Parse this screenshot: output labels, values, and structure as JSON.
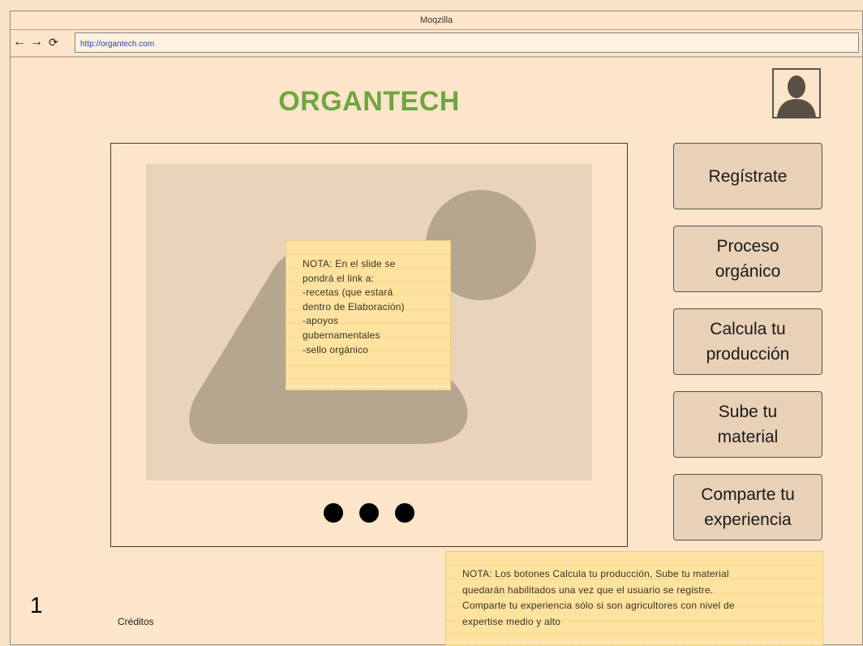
{
  "window": {
    "title": "Moqzilla"
  },
  "nav": {
    "back_icon": "arrow-left-icon",
    "forward_icon": "arrow-right-icon",
    "reload_icon": "reload-icon",
    "url": "http://organtech.com"
  },
  "header": {
    "logo": "ORGANTECH",
    "avatar_icon": "user-silhouette-icon"
  },
  "slider": {
    "image_icon": "image-placeholder-icon",
    "note": {
      "lines": [
        "NOTA: En el slide se",
        "pondrá el link a:",
        "-recetas (que estará",
        "dentro de Elaboración)",
        "-apoyos",
        "gubernamentales",
        "-sello orgánico"
      ]
    },
    "dots": 3
  },
  "sidebar": {
    "buttons": [
      {
        "lines": [
          "Regístrate"
        ]
      },
      {
        "lines": [
          "Proceso",
          "orgánico"
        ]
      },
      {
        "lines": [
          "Calcula tu",
          "producción"
        ]
      },
      {
        "lines": [
          "Sube tu",
          "material"
        ]
      },
      {
        "lines": [
          "Comparte tu",
          "experiencia"
        ]
      }
    ]
  },
  "bottom_note": {
    "lines": [
      "NOTA: Los botones Calcula tu producción, Sube tu material",
      "quedarán habilitados una vez que el usuario se registre.",
      "Comparte tu experiencia sólo si son agricultores con nivel de",
      "expertise medio y alto"
    ]
  },
  "footer": {
    "page_number": "1",
    "credits": "Créditos"
  },
  "colors": {
    "logo": "#70a544",
    "background": "#fde5c9",
    "note": "#fde39f",
    "button": "#e9d1b7"
  }
}
